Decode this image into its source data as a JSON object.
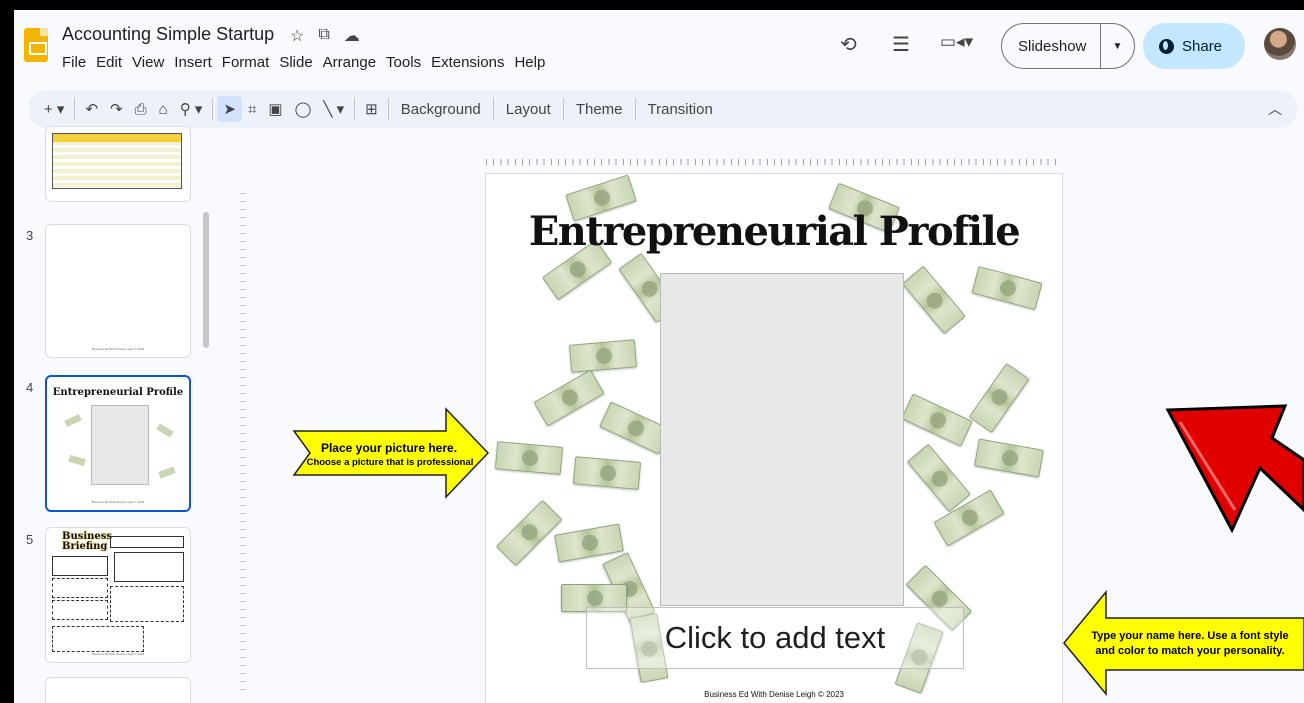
{
  "app": {
    "doc_title": "Accounting Simple Startup",
    "menu": [
      "File",
      "Edit",
      "View",
      "Insert",
      "Format",
      "Slide",
      "Arrange",
      "Tools",
      "Extensions",
      "Help"
    ],
    "slideshow_label": "Slideshow",
    "share_label": "Share"
  },
  "toolbar": {
    "background_label": "Background",
    "layout_label": "Layout",
    "theme_label": "Theme",
    "transition_label": "Transition"
  },
  "filmstrip": {
    "slides": [
      {
        "number": "3",
        "footer": "Business Ed With Denise Leigh © 2023"
      },
      {
        "number": "4",
        "title": "Entrepreneurial Profile",
        "footer": "Business Ed With Denise Leigh © 2023",
        "active": true
      },
      {
        "number": "5",
        "title": "Business Briefing",
        "footer": "Business Ed With Denise Leigh © 2023"
      }
    ]
  },
  "slide": {
    "title": "Entrepreneurial Profile",
    "text_placeholder": "Click to add text",
    "credit": "Business Ed With Denise Leigh © 2023"
  },
  "callouts": {
    "left_line1": "Place your picture here.",
    "left_line2": "Choose a picture that is professional",
    "right_line1": "Type your name here. Use a font style",
    "right_line2": "and color to match your personality."
  },
  "colors": {
    "callout_fill": "#ffff00",
    "red_arrow": "#e00000",
    "accent": "#0b57d0",
    "share_bg": "#c2e7ff"
  }
}
